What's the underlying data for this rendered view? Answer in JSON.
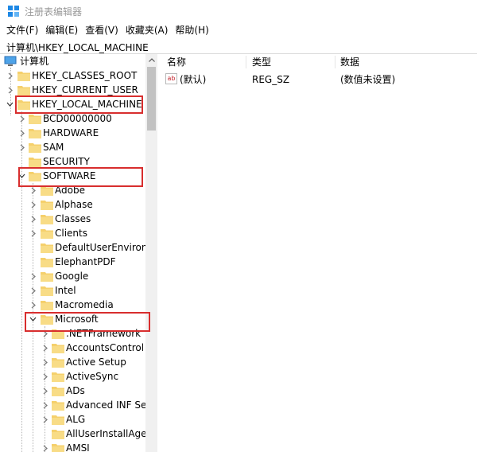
{
  "window": {
    "title": "注册表编辑器"
  },
  "menu": [
    "文件(F)",
    "编辑(E)",
    "查看(V)",
    "收藏夹(A)",
    "帮助(H)"
  ],
  "address": "计算机\\HKEY_LOCAL_MACHINE",
  "tree": {
    "root": "计算机",
    "hives": [
      "HKEY_CLASSES_ROOT",
      "HKEY_CURRENT_USER",
      "HKEY_LOCAL_MACHINE"
    ],
    "hklm_children": [
      "BCD00000000",
      "HARDWARE",
      "SAM",
      "SECURITY",
      "SOFTWARE"
    ],
    "software_children": [
      "Adobe",
      "Alphase",
      "Classes",
      "Clients",
      "DefaultUserEnvironme",
      "ElephantPDF",
      "Google",
      "Intel",
      "Macromedia",
      "Microsoft"
    ],
    "microsoft_children": [
      ".NETFramework",
      "AccountsControl",
      "Active Setup",
      "ActiveSync",
      "ADs",
      "Advanced INF Setu",
      "ALG",
      "AllUserInstallAgent",
      "AMSI"
    ]
  },
  "list": {
    "columns": [
      "名称",
      "类型",
      "数据"
    ],
    "rows": [
      {
        "name": "(默认)",
        "type": "REG_SZ",
        "data": "(数值未设置)"
      }
    ]
  },
  "colors": {
    "highlight": "#d82e2e",
    "folder": "#f5d06c",
    "selection": "#cce8ff"
  }
}
